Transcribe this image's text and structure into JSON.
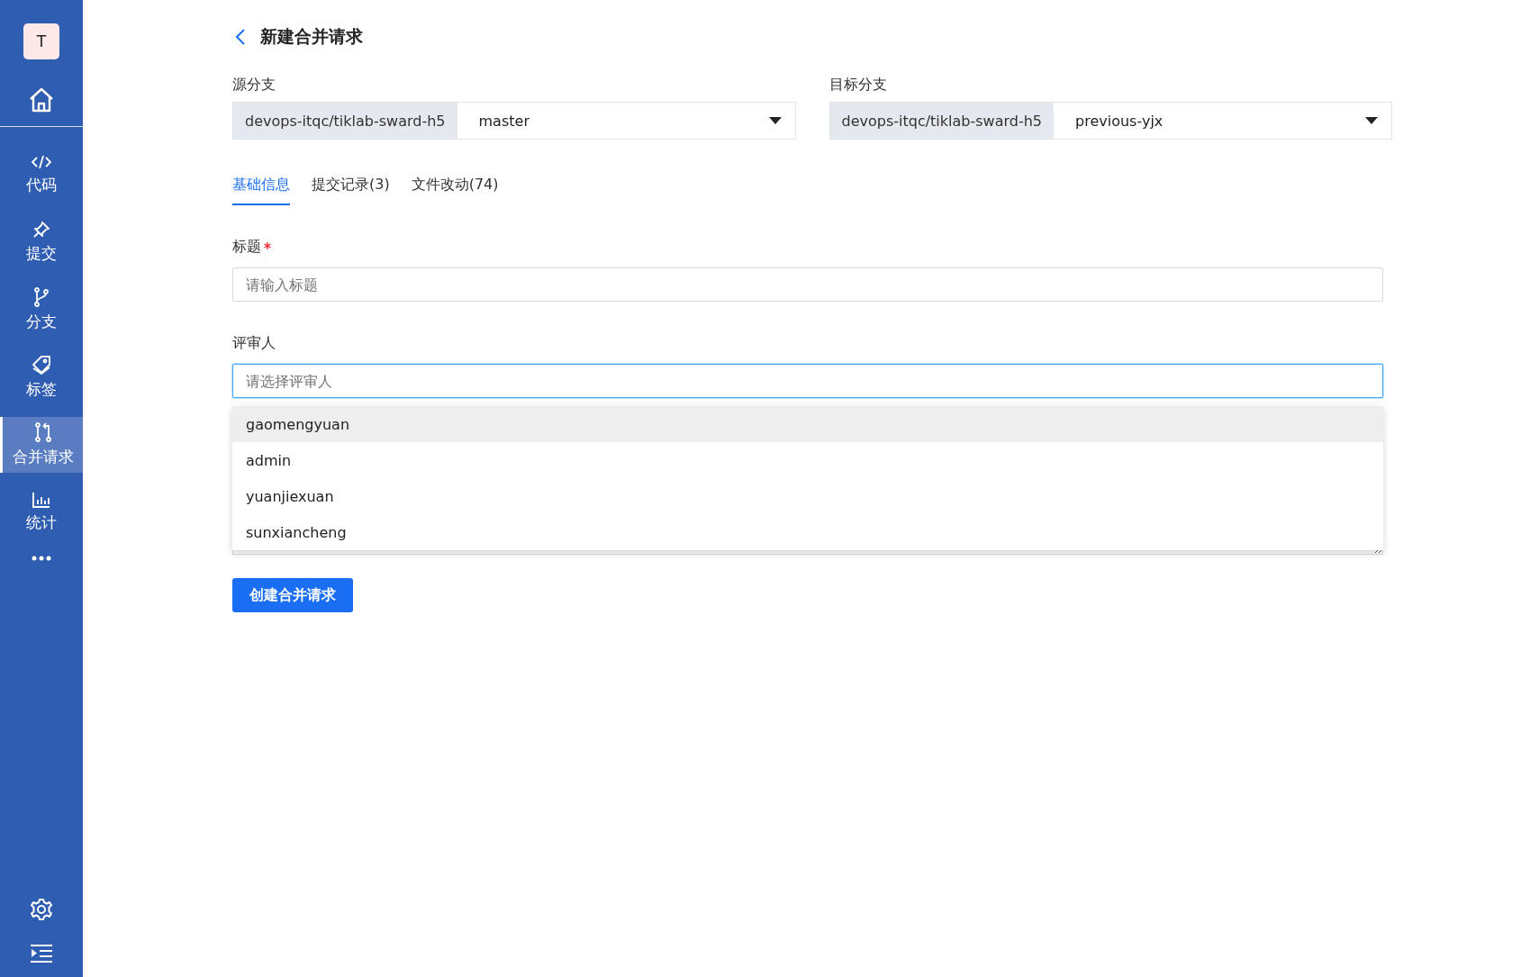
{
  "sidebar": {
    "avatar": "T",
    "items": [
      {
        "label": "代码",
        "selected": false
      },
      {
        "label": "提交",
        "selected": false
      },
      {
        "label": "分支",
        "selected": false
      },
      {
        "label": "标签",
        "selected": false
      },
      {
        "label": "合并请求",
        "selected": true
      },
      {
        "label": "统计",
        "selected": false
      }
    ]
  },
  "page": {
    "title": "新建合并请求"
  },
  "branches": [
    {
      "label": "源分支",
      "repo": "devops-itqc/tiklab-sward-h5",
      "value": "master"
    },
    {
      "label": "目标分支",
      "repo": "devops-itqc/tiklab-sward-h5",
      "value": "previous-yjx"
    }
  ],
  "tabs": [
    {
      "label": "基础信息",
      "selected": true
    },
    {
      "label": "提交记录(3)",
      "selected": false
    },
    {
      "label": "文件改动(74)",
      "selected": false
    }
  ],
  "form": {
    "title_field": {
      "label": "标题",
      "required": true,
      "placeholder": "请输入标题"
    },
    "reviewer_field": {
      "label": "评审人",
      "placeholder": "请选择评审人",
      "focused": true
    },
    "reviewer_options": [
      {
        "label": "gaomengyuan",
        "selected": true
      },
      {
        "label": "admin",
        "selected": false
      },
      {
        "label": "yuanjiexuan",
        "selected": false
      },
      {
        "label": "sunxiancheng",
        "selected": false
      }
    ],
    "submit": "创建合并请求"
  }
}
